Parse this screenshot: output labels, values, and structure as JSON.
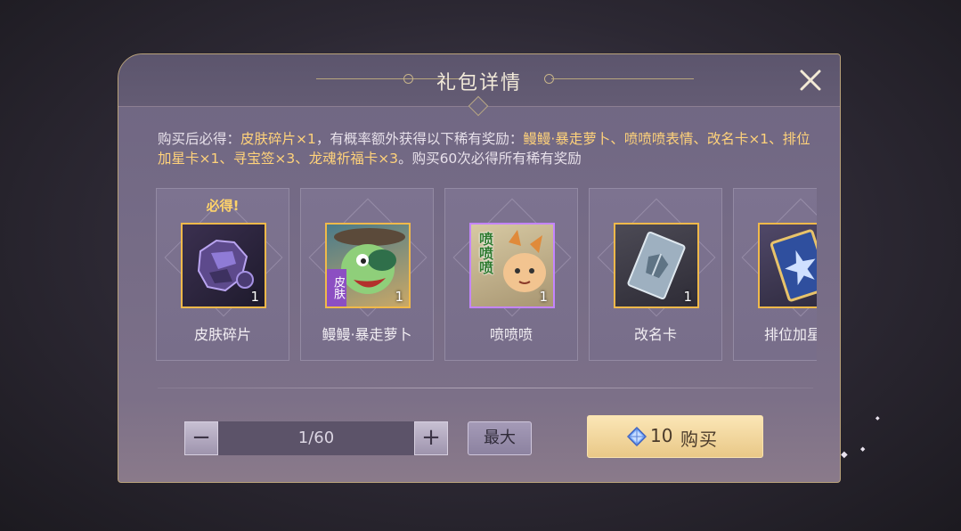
{
  "dialog": {
    "title": "礼包详情",
    "description": {
      "p1": "购买后必得：",
      "h1": "皮肤碎片×1",
      "p2": "，有概率额外获得以下稀有奖励：",
      "h2": "鳗鳗·暴走萝卜、喷喷喷表情、改名卡×1、排位加星卡×1、寻宝签×3、龙魂祈福卡×3",
      "p3": "。购买60次必得所有稀有奖励"
    },
    "items": [
      {
        "badge": "必得!",
        "label": "皮肤碎片",
        "count": "1",
        "icon": "skin-fragment-icon"
      },
      {
        "label": "鳗鳗·暴走萝卜",
        "count": "1",
        "skin_tag": "皮肤",
        "icon": "skin-portrait-icon"
      },
      {
        "label": "喷喷喷",
        "count": "1",
        "emote_text": "喷喷喷",
        "icon": "emote-icon"
      },
      {
        "label": "改名卡",
        "count": "1",
        "icon": "rename-card-icon"
      },
      {
        "label": "排位加星卡",
        "icon": "rank-star-card-icon"
      }
    ],
    "quantity": {
      "value": "1/60",
      "minus": "−",
      "plus": "+"
    },
    "max_button": "最大",
    "buy_button": {
      "price": "10",
      "label": "购买"
    }
  },
  "colors": {
    "highlight": "#ffd27a",
    "rare_frame": "#f0b94a",
    "epic_frame": "#c484ff",
    "buy_button": "#f0d59a"
  }
}
